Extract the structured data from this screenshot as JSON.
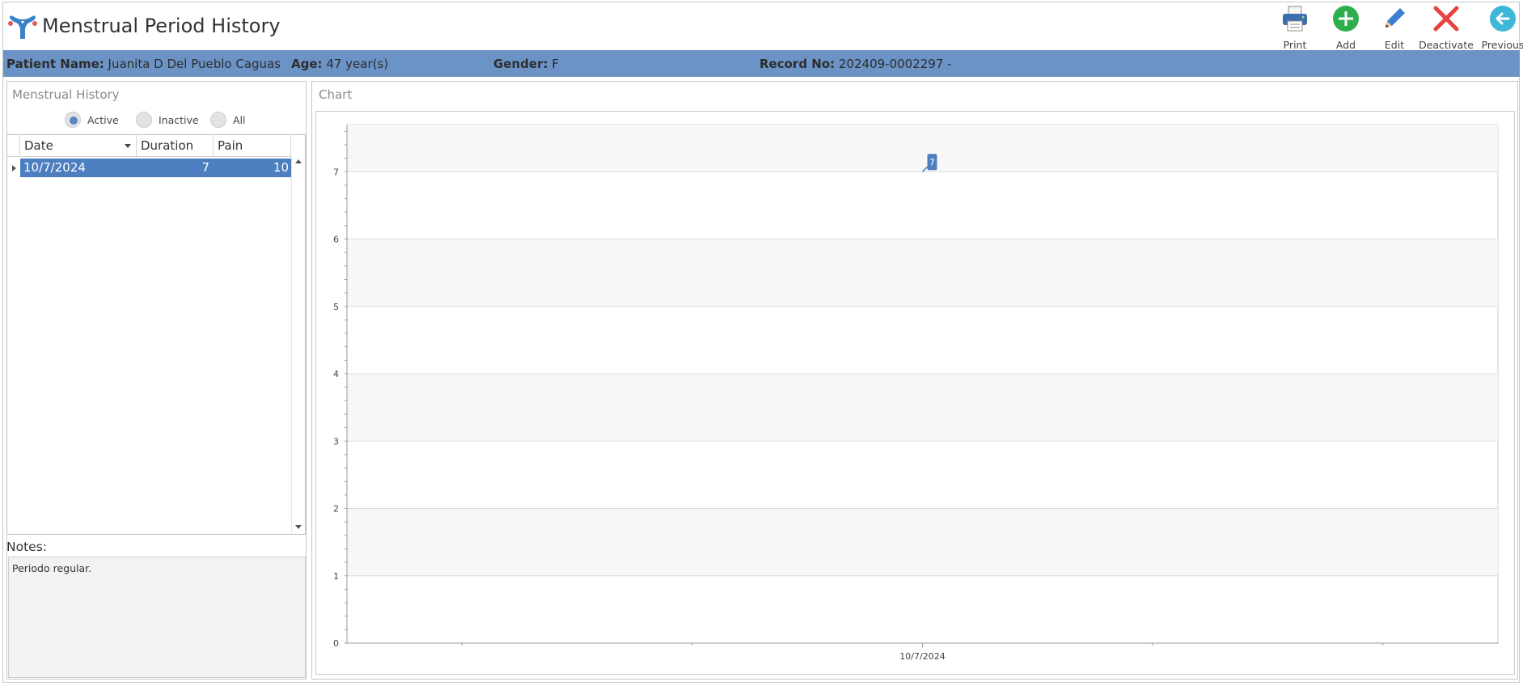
{
  "header": {
    "title": "Menstrual Period History",
    "logo_icon": "uterus-icon"
  },
  "toolbar": {
    "print_label": "Print",
    "add_label": "Add",
    "edit_label": "Edit",
    "deactivate_label": "Deactivate",
    "previous_label": "Previous"
  },
  "patient": {
    "name_label": "Patient Name:",
    "name": "Juanita D Del Pueblo Caguas",
    "age_label": "Age:",
    "age": "47 year(s)",
    "gender_label": "Gender:",
    "gender": "F",
    "record_label": "Record No:",
    "record": "202409-0002297 -"
  },
  "history": {
    "caption": "Menstrual History",
    "filters": [
      {
        "label": "Active",
        "selected": true
      },
      {
        "label": "Inactive",
        "selected": false
      },
      {
        "label": "All",
        "selected": false
      }
    ],
    "columns": [
      "Date",
      "Duration",
      "Pain"
    ],
    "rows": [
      {
        "date": "10/7/2024",
        "duration": "7",
        "pain": "10"
      }
    ]
  },
  "notes": {
    "label": "Notes:",
    "text": "Periodo regular."
  },
  "chart": {
    "caption": "Chart"
  },
  "chart_data": {
    "type": "line",
    "categories": [
      "10/7/2024"
    ],
    "values": [
      7
    ],
    "data_labels": [
      "7"
    ],
    "ylim": [
      0,
      7.7
    ],
    "yticks": [
      0,
      1,
      2,
      3,
      4,
      5,
      6,
      7
    ],
    "grid": true,
    "title": "",
    "xlabel": "",
    "ylabel": "",
    "series_color": "#4d7ebf"
  }
}
